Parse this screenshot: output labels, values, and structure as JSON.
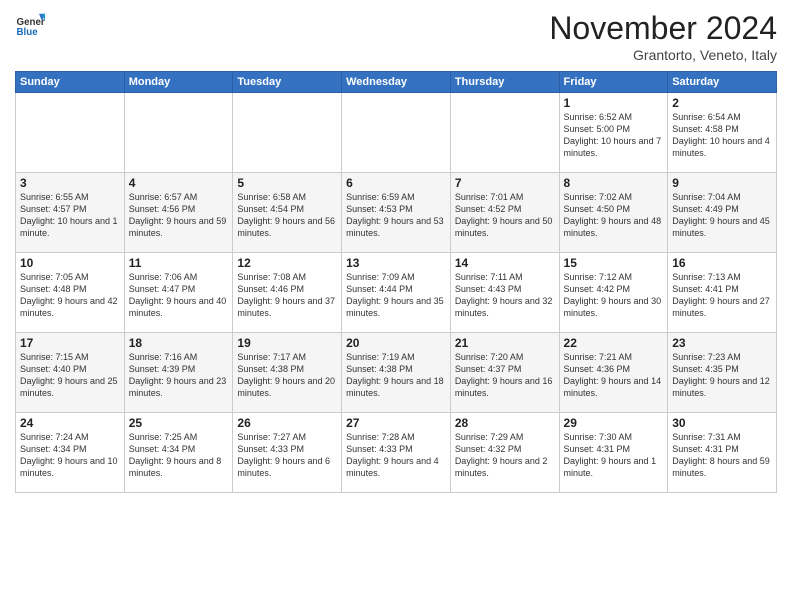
{
  "logo": {
    "general": "General",
    "blue": "Blue"
  },
  "title": "November 2024",
  "location": "Grantorto, Veneto, Italy",
  "days_of_week": [
    "Sunday",
    "Monday",
    "Tuesday",
    "Wednesday",
    "Thursday",
    "Friday",
    "Saturday"
  ],
  "weeks": [
    [
      {
        "day": "",
        "info": ""
      },
      {
        "day": "",
        "info": ""
      },
      {
        "day": "",
        "info": ""
      },
      {
        "day": "",
        "info": ""
      },
      {
        "day": "",
        "info": ""
      },
      {
        "day": "1",
        "info": "Sunrise: 6:52 AM\nSunset: 5:00 PM\nDaylight: 10 hours and 7 minutes."
      },
      {
        "day": "2",
        "info": "Sunrise: 6:54 AM\nSunset: 4:58 PM\nDaylight: 10 hours and 4 minutes."
      }
    ],
    [
      {
        "day": "3",
        "info": "Sunrise: 6:55 AM\nSunset: 4:57 PM\nDaylight: 10 hours and 1 minute."
      },
      {
        "day": "4",
        "info": "Sunrise: 6:57 AM\nSunset: 4:56 PM\nDaylight: 9 hours and 59 minutes."
      },
      {
        "day": "5",
        "info": "Sunrise: 6:58 AM\nSunset: 4:54 PM\nDaylight: 9 hours and 56 minutes."
      },
      {
        "day": "6",
        "info": "Sunrise: 6:59 AM\nSunset: 4:53 PM\nDaylight: 9 hours and 53 minutes."
      },
      {
        "day": "7",
        "info": "Sunrise: 7:01 AM\nSunset: 4:52 PM\nDaylight: 9 hours and 50 minutes."
      },
      {
        "day": "8",
        "info": "Sunrise: 7:02 AM\nSunset: 4:50 PM\nDaylight: 9 hours and 48 minutes."
      },
      {
        "day": "9",
        "info": "Sunrise: 7:04 AM\nSunset: 4:49 PM\nDaylight: 9 hours and 45 minutes."
      }
    ],
    [
      {
        "day": "10",
        "info": "Sunrise: 7:05 AM\nSunset: 4:48 PM\nDaylight: 9 hours and 42 minutes."
      },
      {
        "day": "11",
        "info": "Sunrise: 7:06 AM\nSunset: 4:47 PM\nDaylight: 9 hours and 40 minutes."
      },
      {
        "day": "12",
        "info": "Sunrise: 7:08 AM\nSunset: 4:46 PM\nDaylight: 9 hours and 37 minutes."
      },
      {
        "day": "13",
        "info": "Sunrise: 7:09 AM\nSunset: 4:44 PM\nDaylight: 9 hours and 35 minutes."
      },
      {
        "day": "14",
        "info": "Sunrise: 7:11 AM\nSunset: 4:43 PM\nDaylight: 9 hours and 32 minutes."
      },
      {
        "day": "15",
        "info": "Sunrise: 7:12 AM\nSunset: 4:42 PM\nDaylight: 9 hours and 30 minutes."
      },
      {
        "day": "16",
        "info": "Sunrise: 7:13 AM\nSunset: 4:41 PM\nDaylight: 9 hours and 27 minutes."
      }
    ],
    [
      {
        "day": "17",
        "info": "Sunrise: 7:15 AM\nSunset: 4:40 PM\nDaylight: 9 hours and 25 minutes."
      },
      {
        "day": "18",
        "info": "Sunrise: 7:16 AM\nSunset: 4:39 PM\nDaylight: 9 hours and 23 minutes."
      },
      {
        "day": "19",
        "info": "Sunrise: 7:17 AM\nSunset: 4:38 PM\nDaylight: 9 hours and 20 minutes."
      },
      {
        "day": "20",
        "info": "Sunrise: 7:19 AM\nSunset: 4:38 PM\nDaylight: 9 hours and 18 minutes."
      },
      {
        "day": "21",
        "info": "Sunrise: 7:20 AM\nSunset: 4:37 PM\nDaylight: 9 hours and 16 minutes."
      },
      {
        "day": "22",
        "info": "Sunrise: 7:21 AM\nSunset: 4:36 PM\nDaylight: 9 hours and 14 minutes."
      },
      {
        "day": "23",
        "info": "Sunrise: 7:23 AM\nSunset: 4:35 PM\nDaylight: 9 hours and 12 minutes."
      }
    ],
    [
      {
        "day": "24",
        "info": "Sunrise: 7:24 AM\nSunset: 4:34 PM\nDaylight: 9 hours and 10 minutes."
      },
      {
        "day": "25",
        "info": "Sunrise: 7:25 AM\nSunset: 4:34 PM\nDaylight: 9 hours and 8 minutes."
      },
      {
        "day": "26",
        "info": "Sunrise: 7:27 AM\nSunset: 4:33 PM\nDaylight: 9 hours and 6 minutes."
      },
      {
        "day": "27",
        "info": "Sunrise: 7:28 AM\nSunset: 4:33 PM\nDaylight: 9 hours and 4 minutes."
      },
      {
        "day": "28",
        "info": "Sunrise: 7:29 AM\nSunset: 4:32 PM\nDaylight: 9 hours and 2 minutes."
      },
      {
        "day": "29",
        "info": "Sunrise: 7:30 AM\nSunset: 4:31 PM\nDaylight: 9 hours and 1 minute."
      },
      {
        "day": "30",
        "info": "Sunrise: 7:31 AM\nSunset: 4:31 PM\nDaylight: 8 hours and 59 minutes."
      }
    ]
  ]
}
